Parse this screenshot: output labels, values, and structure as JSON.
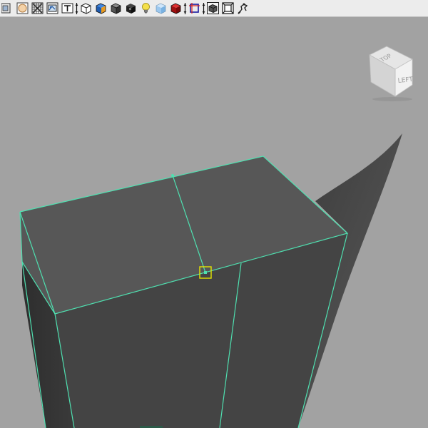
{
  "toolbar": {
    "buttons": [
      {
        "name": "camera-attributes-button",
        "icon": "camera-partial-icon"
      },
      {
        "name": "image-plane-button",
        "icon": "image-plane-icon"
      },
      {
        "name": "grid-toggle-button",
        "icon": "grid-icon"
      },
      {
        "name": "film-gate-button",
        "icon": "film-gate-icon"
      },
      {
        "name": "texture-button",
        "icon": "texture-text-icon"
      },
      {
        "name": "wireframe-button",
        "icon": "wireframe-cube-icon"
      },
      {
        "name": "smooth-shade-button",
        "icon": "smooth-shade-cube-icon"
      },
      {
        "name": "wireframe-on-shaded-button",
        "icon": "wire-on-shaded-cube-icon"
      },
      {
        "name": "xray-button",
        "icon": "xray-cube-icon"
      },
      {
        "name": "use-all-lights-button",
        "icon": "light-bulb-icon"
      },
      {
        "name": "shadows-button",
        "icon": "shadow-cube-icon"
      },
      {
        "name": "isolate-select-button",
        "icon": "red-cube-icon"
      },
      {
        "name": "resolution-gate-button",
        "icon": "resolution-gate-icon"
      },
      {
        "name": "field-chart-button",
        "icon": "field-chart-cube-icon"
      },
      {
        "name": "safe-action-button",
        "icon": "safe-action-icon"
      },
      {
        "name": "camera-tool-button",
        "icon": "camera-tool-icon"
      }
    ]
  },
  "viewcube": {
    "top_label": "TOP",
    "left_label": "LEFT"
  },
  "colors": {
    "viewport_background": "#a2a2a2",
    "toolbar_background": "#ececec",
    "selection_edge": "#4fe0b0",
    "selected_vertex": "#e5e500",
    "face_top": "#575757",
    "face_front": "#444444",
    "face_left": "#333333"
  }
}
